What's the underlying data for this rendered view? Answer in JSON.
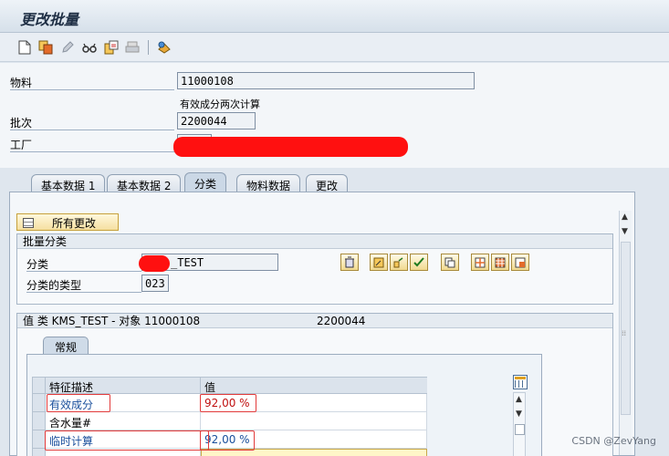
{
  "window": {
    "title": "更改批量"
  },
  "toolbar": {
    "icons": [
      "new-document-icon",
      "copy-icon",
      "edit-pencil-icon",
      "display-glasses-icon",
      "copy-from-icon",
      "print-icon",
      "classification-icon"
    ]
  },
  "header": {
    "material_label": "物料",
    "material_value": "11000108",
    "material_desc": "有效成分两次计算",
    "batch_label": "批次",
    "batch_value": "2200044",
    "plant_label": "工厂"
  },
  "tabs": [
    {
      "label": "基本数据 1",
      "active": false
    },
    {
      "label": "基本数据 2",
      "active": false
    },
    {
      "label": "分类",
      "active": true
    },
    {
      "label": "物料数据",
      "active": false
    },
    {
      "label": "更改",
      "active": false
    }
  ],
  "panel": {
    "all_changes_button": "所有更改",
    "batch_class_group_title": "批量分类",
    "class_label": "分类",
    "class_value": "_TEST",
    "class_type_label": "分类的类型",
    "class_type_value": "023",
    "values_group_title": "值 类 KMS_TEST - 对象 11000108",
    "values_group_batch": "2200044",
    "subtab_label": "常规",
    "table": {
      "col_char": "特征描述",
      "col_value": "值",
      "rows": [
        {
          "char": "有效成分",
          "value": "92,00 %"
        },
        {
          "char": "含水量#",
          "value": ""
        },
        {
          "char": "临时计算",
          "value": "92,00 %"
        }
      ]
    }
  },
  "watermark": "CSDN @ZevYang",
  "colors": {
    "accent_red": "#e23b3b",
    "link_blue": "#1a4f9c",
    "value_red": "#c01010"
  }
}
